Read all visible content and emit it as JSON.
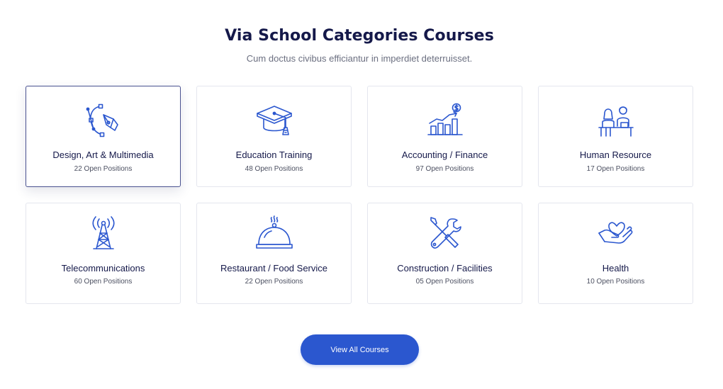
{
  "header": {
    "title": "Via School Categories Courses",
    "subtitle": "Cum doctus civibus efficiantur in imperdiet deterruisset."
  },
  "categories": [
    {
      "title": "Design, Art & Multimedia",
      "positions": "22 Open Positions",
      "icon": "pen-tool-icon"
    },
    {
      "title": "Education Training",
      "positions": "48 Open Positions",
      "icon": "graduation-cap-icon"
    },
    {
      "title": "Accounting / Finance",
      "positions": "97 Open Positions",
      "icon": "bar-chart-dollar-icon"
    },
    {
      "title": "Human Resource",
      "positions": "17 Open Positions",
      "icon": "people-at-desk-icon"
    },
    {
      "title": "Telecommunications",
      "positions": "60 Open Positions",
      "icon": "radio-tower-icon"
    },
    {
      "title": "Restaurant / Food Service",
      "positions": "22 Open Positions",
      "icon": "cloche-icon"
    },
    {
      "title": "Construction / Facilities",
      "positions": "05 Open Positions",
      "icon": "wrench-screwdriver-icon"
    },
    {
      "title": "Health",
      "positions": "10 Open Positions",
      "icon": "heart-hand-icon"
    }
  ],
  "cta": {
    "label": "View All Courses"
  },
  "colors": {
    "accent": "#2b57cf",
    "heading": "#15194a",
    "icon": "#2b57cf"
  }
}
